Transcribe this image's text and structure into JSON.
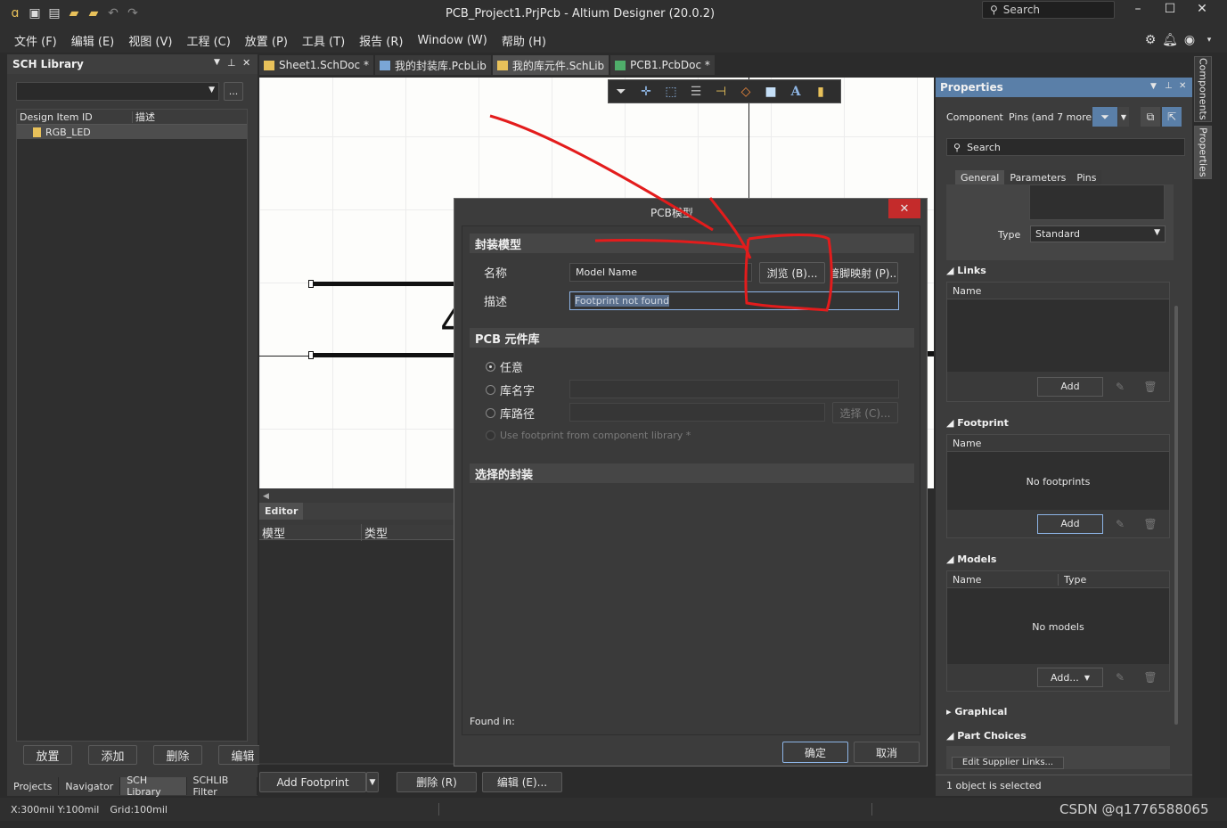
{
  "window": {
    "title": "PCB_Project1.PrjPcb - Altium Designer (20.0.2)",
    "search_placeholder": "Search"
  },
  "menu": [
    "文件 (F)",
    "编辑 (E)",
    "视图 (V)",
    "工程 (C)",
    "放置 (P)",
    "工具 (T)",
    "报告 (R)",
    "Window (W)",
    "帮助 (H)"
  ],
  "left_panel": {
    "title": "SCH Library",
    "col_id": "Design Item ID",
    "col_desc": "描述",
    "items": [
      "RGB_LED"
    ],
    "buttons": [
      "放置",
      "添加",
      "删除",
      "编辑"
    ],
    "tabs": [
      "Projects",
      "Navigator",
      "SCH Library",
      "SCHLIB Filter"
    ],
    "filter_button": "..."
  },
  "doc_tabs": [
    {
      "label": "Sheet1.SchDoc *",
      "icon_color": "#e8c15a"
    },
    {
      "label": "我的封装库.PcbLib",
      "icon_color": "#7aa6d6"
    },
    {
      "label": "我的库元件.SchLib",
      "icon_color": "#e8c15a",
      "active": true
    },
    {
      "label": "PCB1.PcbDoc *",
      "icon_color": "#4fae6a"
    }
  ],
  "editor": {
    "title": "Editor",
    "col_model": "模型",
    "col_type": "类型",
    "add_footprint": "Add Footprint",
    "delete": "删除 (R)",
    "edit": "编辑 (E)..."
  },
  "dialog": {
    "title": "PCB模型",
    "section_model": "封装模型",
    "label_name": "名称",
    "name_value": "Model Name",
    "browse": "浏览 (B)...",
    "pin_map": "管脚映射 (P)...",
    "label_desc": "描述",
    "desc_value": "Footprint not found",
    "section_lib": "PCB 元件库",
    "radio_any": "任意",
    "radio_libname": "库名字",
    "radio_libpath": "库路径",
    "select": "选择 (C)...",
    "use_footprint": "Use footprint from component library *",
    "section_selected": "选择的封装",
    "found_in": "Found in:",
    "ok": "确定",
    "cancel": "取消"
  },
  "properties": {
    "title": "Properties",
    "component_label": "Component",
    "component_value": "Pins (and 7 more)",
    "search_placeholder": "Search",
    "tabs": [
      "General",
      "Parameters",
      "Pins"
    ],
    "type_label": "Type",
    "type_value": "Standard",
    "links": {
      "title": "Links",
      "col": "Name",
      "add": "Add"
    },
    "footprint": {
      "title": "Footprint",
      "col": "Name",
      "empty": "No footprints",
      "add": "Add"
    },
    "models": {
      "title": "Models",
      "col_name": "Name",
      "col_type": "Type",
      "empty": "No models",
      "add": "Add..."
    },
    "graphical": "Graphical",
    "part_choices": "Part Choices",
    "edit_supplier": "Edit Supplier Links...",
    "status": "1 object is selected"
  },
  "side_tabs": [
    "Components",
    "Properties"
  ],
  "status": {
    "coords": "X:300mil Y:100mil",
    "grid": "Grid:100mil",
    "watermark": "CSDN @q1776588065"
  },
  "canvas_glyph": "4"
}
